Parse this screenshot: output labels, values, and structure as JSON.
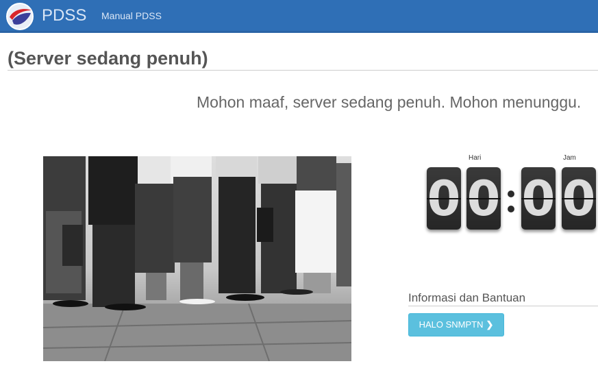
{
  "navbar": {
    "brand": "PDSS",
    "links": [
      {
        "label": "Manual PDSS"
      }
    ]
  },
  "page": {
    "title": "(Server sedang penuh)",
    "message": "Mohon maaf, server sedang penuh. Mohon menunggu."
  },
  "countdown": {
    "units": [
      {
        "label": "Hari",
        "digits": [
          "0",
          "0"
        ]
      },
      {
        "label": "Jam",
        "digits": [
          "0",
          "0"
        ]
      }
    ]
  },
  "info": {
    "title": "Informasi dan Bantuan",
    "button_label": "HALO SNMPTN",
    "button_icon": "chevron-right-icon"
  },
  "colors": {
    "navbar": "#2f6fb6",
    "button": "#5bc0de",
    "flip_card": "#2e2e2e"
  }
}
